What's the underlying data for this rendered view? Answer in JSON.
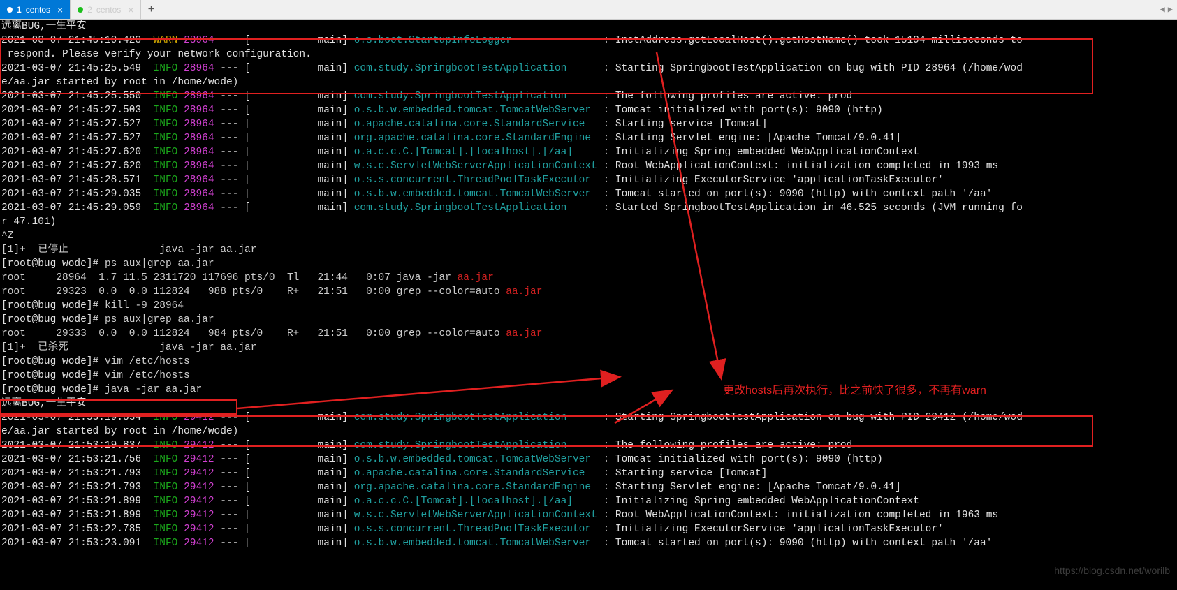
{
  "tabs": {
    "items": [
      {
        "num": "1",
        "label": "centos",
        "active": true
      },
      {
        "num": "2",
        "label": "centos",
        "active": false
      }
    ],
    "add": "+",
    "nav_left": "◀",
    "nav_right": "▶"
  },
  "annotation": "更改hosts后再次执行，比之前快了很多，不再有warn",
  "watermark": "https://blog.csdn.net/worilb",
  "banner1": "远离BUG,一生平安",
  "banner2": "远离BUG,一生平安",
  "logs1": [
    {
      "ts": "2021-03-07 21:45:10.423",
      "level": "WARN",
      "pid": "28964",
      "thread": "main",
      "logger": "o.s.boot.StartupInfoLogger",
      "msg": "InetAddress.getLocalHost().getHostName() took 15194 milliseconds to"
    },
    {
      "cont": " respond. Please verify your network configuration."
    },
    {
      "ts": "2021-03-07 21:45:25.549",
      "level": "INFO",
      "pid": "28964",
      "thread": "main",
      "logger": "com.study.SpringbootTestApplication",
      "msg": "Starting SpringbootTestApplication on bug with PID 28964 (/home/wod"
    },
    {
      "cont": "e/aa.jar started by root in /home/wode)"
    },
    {
      "ts": "2021-03-07 21:45:25.550",
      "level": "INFO",
      "pid": "28964",
      "thread": "main",
      "logger": "com.study.SpringbootTestApplication",
      "msg": "The following profiles are active: prod"
    },
    {
      "ts": "2021-03-07 21:45:27.503",
      "level": "INFO",
      "pid": "28964",
      "thread": "main",
      "logger": "o.s.b.w.embedded.tomcat.TomcatWebServer",
      "msg": "Tomcat initialized with port(s): 9090 (http)"
    },
    {
      "ts": "2021-03-07 21:45:27.527",
      "level": "INFO",
      "pid": "28964",
      "thread": "main",
      "logger": "o.apache.catalina.core.StandardService",
      "msg": "Starting service [Tomcat]"
    },
    {
      "ts": "2021-03-07 21:45:27.527",
      "level": "INFO",
      "pid": "28964",
      "thread": "main",
      "logger": "org.apache.catalina.core.StandardEngine",
      "msg": "Starting Servlet engine: [Apache Tomcat/9.0.41]"
    },
    {
      "ts": "2021-03-07 21:45:27.620",
      "level": "INFO",
      "pid": "28964",
      "thread": "main",
      "logger": "o.a.c.c.C.[Tomcat].[localhost].[/aa]",
      "msg": "Initializing Spring embedded WebApplicationContext"
    },
    {
      "ts": "2021-03-07 21:45:27.620",
      "level": "INFO",
      "pid": "28964",
      "thread": "main",
      "logger": "w.s.c.ServletWebServerApplicationContext",
      "msg": "Root WebApplicationContext: initialization completed in 1993 ms"
    },
    {
      "ts": "2021-03-07 21:45:28.571",
      "level": "INFO",
      "pid": "28964",
      "thread": "main",
      "logger": "o.s.s.concurrent.ThreadPoolTaskExecutor",
      "msg": "Initializing ExecutorService 'applicationTaskExecutor'"
    },
    {
      "ts": "2021-03-07 21:45:29.035",
      "level": "INFO",
      "pid": "28964",
      "thread": "main",
      "logger": "o.s.b.w.embedded.tomcat.TomcatWebServer",
      "msg": "Tomcat started on port(s): 9090 (http) with context path '/aa'"
    },
    {
      "ts": "2021-03-07 21:45:29.059",
      "level": "INFO",
      "pid": "28964",
      "thread": "main",
      "logger": "com.study.SpringbootTestApplication",
      "msg": "Started SpringbootTestApplication in 46.525 seconds (JVM running fo"
    },
    {
      "cont": "r 47.101)"
    }
  ],
  "shell": {
    "ctrlz": "^Z",
    "stopped": "[1]+  已停止               java -jar aa.jar",
    "p1": "[root@bug wode]# ",
    "c1": "ps aux|grep aa.jar",
    "ps1a": "root     28964  1.7 11.5 2311720 117696 pts/0  Tl   21:44   0:07 java -jar ",
    "ps1a_jar": "aa.jar",
    "ps1b": "root     29323  0.0  0.0 112824   988 pts/0    R+   21:51   0:00 grep --color=auto ",
    "ps1b_jar": "aa.jar",
    "p2": "[root@bug wode]# ",
    "c2": "kill -9 28964",
    "p3": "[root@bug wode]# ",
    "c3": "ps aux|grep aa.jar",
    "ps2": "root     29333  0.0  0.0 112824   984 pts/0    R+   21:51   0:00 grep --color=auto ",
    "ps2_jar": "aa.jar",
    "killed": "[1]+  已杀死               java -jar aa.jar",
    "p4": "[root@bug wode]# ",
    "c4": "vim /etc/hosts",
    "p5": "[root@bug wode]# ",
    "c5": "vim /etc/hosts",
    "p6": "[root@bug wode]# ",
    "c6": "java -jar aa.jar"
  },
  "logs2": [
    {
      "ts": "2021-03-07 21:53:19.834",
      "level": "INFO",
      "pid": "29412",
      "thread": "main",
      "logger": "com.study.SpringbootTestApplication",
      "msg": "Starting SpringbootTestApplication on bug with PID 29412 (/home/wod"
    },
    {
      "cont": "e/aa.jar started by root in /home/wode)"
    },
    {
      "ts": "2021-03-07 21:53:19.837",
      "level": "INFO",
      "pid": "29412",
      "thread": "main",
      "logger": "com.study.SpringbootTestApplication",
      "msg": "The following profiles are active: prod"
    },
    {
      "ts": "2021-03-07 21:53:21.756",
      "level": "INFO",
      "pid": "29412",
      "thread": "main",
      "logger": "o.s.b.w.embedded.tomcat.TomcatWebServer",
      "msg": "Tomcat initialized with port(s): 9090 (http)"
    },
    {
      "ts": "2021-03-07 21:53:21.793",
      "level": "INFO",
      "pid": "29412",
      "thread": "main",
      "logger": "o.apache.catalina.core.StandardService",
      "msg": "Starting service [Tomcat]"
    },
    {
      "ts": "2021-03-07 21:53:21.793",
      "level": "INFO",
      "pid": "29412",
      "thread": "main",
      "logger": "org.apache.catalina.core.StandardEngine",
      "msg": "Starting Servlet engine: [Apache Tomcat/9.0.41]"
    },
    {
      "ts": "2021-03-07 21:53:21.899",
      "level": "INFO",
      "pid": "29412",
      "thread": "main",
      "logger": "o.a.c.c.C.[Tomcat].[localhost].[/aa]",
      "msg": "Initializing Spring embedded WebApplicationContext"
    },
    {
      "ts": "2021-03-07 21:53:21.899",
      "level": "INFO",
      "pid": "29412",
      "thread": "main",
      "logger": "w.s.c.ServletWebServerApplicationContext",
      "msg": "Root WebApplicationContext: initialization completed in 1963 ms"
    },
    {
      "ts": "2021-03-07 21:53:22.785",
      "level": "INFO",
      "pid": "29412",
      "thread": "main",
      "logger": "o.s.s.concurrent.ThreadPoolTaskExecutor",
      "msg": "Initializing ExecutorService 'applicationTaskExecutor'"
    },
    {
      "ts": "2021-03-07 21:53:23.091",
      "level": "INFO",
      "pid": "29412",
      "thread": "main",
      "logger": "o.s.b.w.embedded.tomcat.TomcatWebServer",
      "msg": "Tomcat started on port(s): 9090 (http) with context path '/aa'"
    }
  ]
}
